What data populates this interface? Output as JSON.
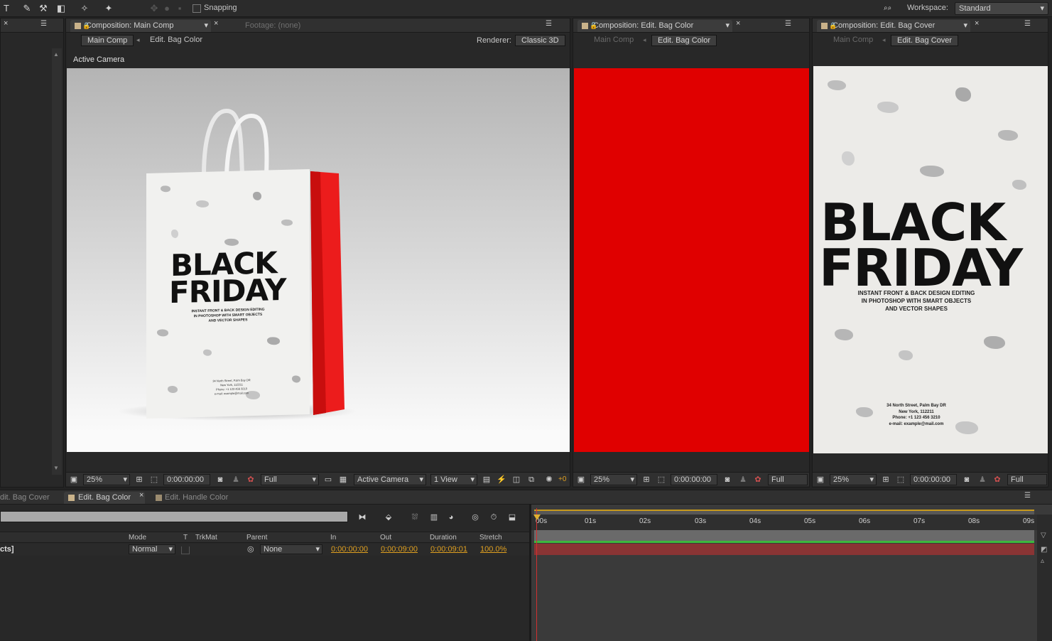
{
  "toolbar": {
    "snapping_label": "Snapping",
    "workspace_label": "Workspace:",
    "workspace_value": "Standard"
  },
  "main_panel": {
    "tab_title": "Composition: Main Comp",
    "tab_footage": "Footage: (none)",
    "crumbs": [
      "Main Comp",
      "Edit. Bag Color"
    ],
    "renderer_label": "Renderer:",
    "renderer_value": "Classic 3D",
    "view_label": "Active Camera",
    "zoom": "25%",
    "timecode": "0:00:00:00",
    "resolution": "Full",
    "camera": "Active Camera",
    "views": "1 View",
    "exposure": "+0"
  },
  "bag": {
    "title1": "BLACK",
    "title2": "FRIDAY",
    "sub_lines": [
      "INSTANT FRONT & BACK DESIGN EDITING",
      "IN PHOTOSHOP WITH SMART OBJECTS",
      "AND VECTOR SHAPES"
    ],
    "address_lines": [
      "34 North Street, Palm Bay DR",
      "New York, 112211",
      "Phone: +1 123 456 3210",
      "e-mail: example@mail.com"
    ]
  },
  "color_panel": {
    "tab_title": "Composition: Edit. Bag Color",
    "crumbs": [
      "Main Comp",
      "Edit. Bag Color"
    ],
    "zoom": "25%",
    "timecode": "0:00:00:00",
    "resolution": "Full",
    "fill_color": "#e00000"
  },
  "cover_panel": {
    "tab_title": "Composition: Edit. Bag Cover",
    "crumbs": [
      "Main Comp",
      "Edit. Bag Cover"
    ],
    "zoom": "25%",
    "timecode": "0:00:00:00",
    "resolution": "Full"
  },
  "timeline": {
    "tabs": [
      "dit. Bag Cover",
      "Edit. Bag Color",
      "Edit. Handle Color"
    ],
    "columns": {
      "mode": "Mode",
      "t": "T",
      "trkmat": "TrkMat",
      "parent": "Parent",
      "in": "In",
      "out": "Out",
      "duration": "Duration",
      "stretch": "Stretch"
    },
    "layer": {
      "name": "cts]",
      "mode": "Normal",
      "parent": "None",
      "in": "0:00:00:00",
      "out": "0:00:09:00",
      "duration": "0:00:09:01",
      "stretch": "100.0%"
    },
    "ruler": [
      "00s",
      "01s",
      "02s",
      "03s",
      "04s",
      "05s",
      "06s",
      "07s",
      "08s",
      "09s"
    ]
  }
}
